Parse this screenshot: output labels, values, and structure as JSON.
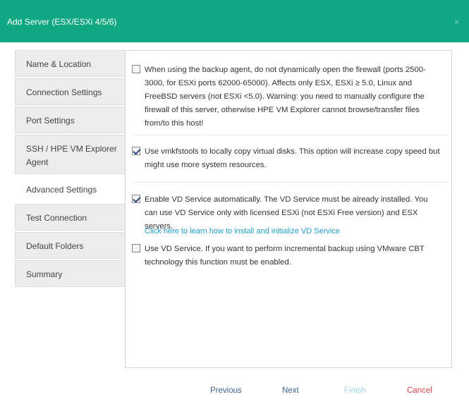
{
  "window": {
    "title": "Add Server (ESX/ESXi 4/5/6)",
    "close_glyph": "×"
  },
  "sidebar": {
    "items": [
      {
        "label": "Name & Location"
      },
      {
        "label": "Connection Settings"
      },
      {
        "label": "Port Settings"
      },
      {
        "label": "SSH / HPE VM Explorer Agent"
      },
      {
        "label": "Advanced Settings",
        "active": true
      },
      {
        "label": "Test Connection"
      },
      {
        "label": "Default Folders"
      },
      {
        "label": "Summary"
      }
    ]
  },
  "options": {
    "firewall": {
      "checked": false,
      "text": "When using the backup agent, do not dynamically open the firewall (ports 2500-3000, for ESXi ports 62000-65000). Affects only ESX, ESXi ≥ 5.0, Linux and FreeBSD servers (not ESXi <5.0). Warning: you need to manually configure the firewall of this server, otherwise HPE VM Explorer cannot browse/transfer files from/to this host!"
    },
    "vmkfstools": {
      "checked": true,
      "text": "Use vmkfstools to locally copy virtual disks. This option will increase copy speed but might use more system resources."
    },
    "vd_auto": {
      "checked": true,
      "text": "Enable VD Service automatically. The VD Service must be already installed. You can use VD Service only with licensed ESXi (not ESXi Free version) and ESX servers."
    },
    "vd_link": "Click here to learn how to install and initialize VD Service",
    "vd_use": {
      "checked": false,
      "text": "Use VD Service. If you want to perform incremental backup using VMware CBT technology this function must be enabled."
    }
  },
  "footer": {
    "previous": "Previous",
    "next": "Next",
    "finish": "Finish",
    "cancel": "Cancel"
  },
  "colors": {
    "titlebar": "#10a882",
    "link": "#1a9fc9",
    "nav_button": "#3d5f8e",
    "disabled_button": "#9fd3e6",
    "cancel": "#d64545"
  }
}
